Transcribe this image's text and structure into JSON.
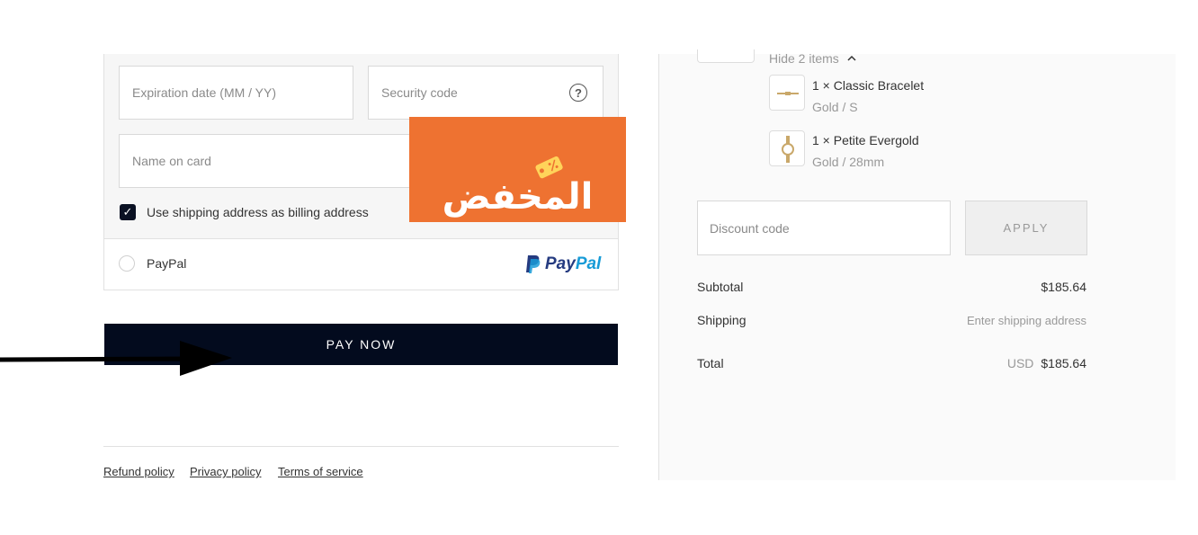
{
  "payment": {
    "expiry_placeholder": "Expiration date (MM / YY)",
    "security_placeholder": "Security code",
    "help_icon": "?",
    "name_placeholder": "Name on card",
    "billing_label": "Use shipping address as billing address",
    "billing_checked": true,
    "paypal_label": "PayPal",
    "paypal_logo_p": "P",
    "paypal_logo_pay": "Pay",
    "paypal_logo_pal": "Pal"
  },
  "promo_badge": {
    "text": "المخفض",
    "color": "#ee7231"
  },
  "pay_button_label": "PAY NOW",
  "footer": {
    "refund": "Refund policy",
    "privacy": "Privacy policy",
    "terms": "Terms of service"
  },
  "order_summary": {
    "toggle_label": "Hide 2 items",
    "items": [
      {
        "name": "1 × Classic Bracelet",
        "variant": "Gold / S"
      },
      {
        "name": "1 × Petite Evergold",
        "variant": "Gold / 28mm"
      }
    ],
    "discount_placeholder": "Discount code",
    "apply_label": "APPLY",
    "subtotal_label": "Subtotal",
    "subtotal_value": "$185.64",
    "shipping_label": "Shipping",
    "shipping_value": "Enter shipping address",
    "total_label": "Total",
    "total_currency": "USD",
    "total_value": "$185.64"
  },
  "colors": {
    "pay_button": "#030b1e",
    "accent": "#ee7231"
  }
}
